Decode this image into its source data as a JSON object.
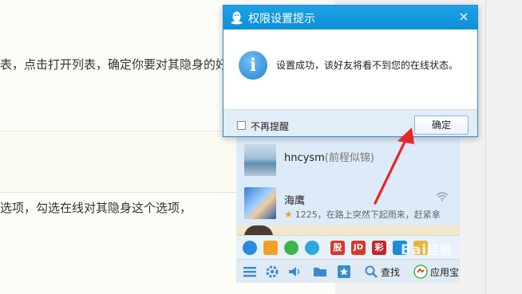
{
  "article": {
    "step1_text": "表，点击打开列表，确定你要对其隐身的好友",
    "step2_text": "选项，勾选在线对其隐身这个选项，"
  },
  "dialog": {
    "title": "权限设置提示",
    "close_label": "×",
    "info_glyph": "i",
    "message": "设置成功，该好友将看不到您的在线状态。",
    "checkbox_label": "不再提醒",
    "ok_label": "确定"
  },
  "contacts": [
    {
      "name": "hncysm",
      "remark": "(前程似锦)",
      "status": ""
    },
    {
      "name": "海鹰",
      "level": "1225",
      "status": "，在路上突然下起雨来，赶紧拿"
    }
  ],
  "apps": [
    "qq-browser-icon",
    "qq-pet-icon",
    "music-icon",
    "video-play-icon",
    "stock-icon",
    "jd-icon",
    "lottery-icon",
    "security-icon",
    "game-icon"
  ],
  "app_labels": {
    "stock": "股",
    "jd": "JD",
    "lottery": "彩"
  },
  "toolbar": {
    "search_label": "查找",
    "appstore_label": "应用宝"
  },
  "watermark": {
    "text": "Bai",
    "suffix": "经验"
  },
  "colors": {
    "title_bar": "#0d8fd8",
    "accent": "#2683d2",
    "arrow": "#e8262a"
  }
}
